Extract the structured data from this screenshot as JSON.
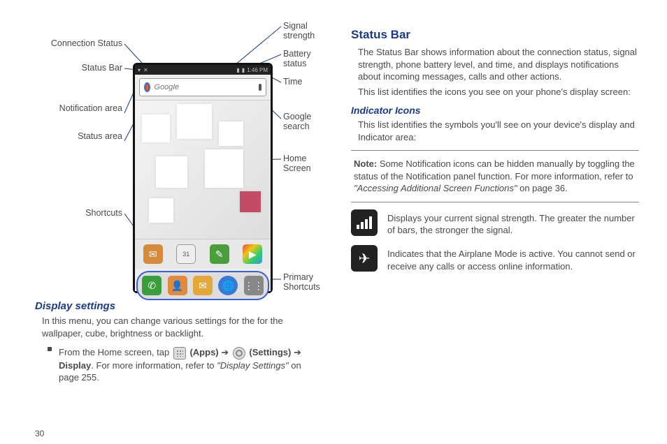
{
  "labels": {
    "connection_status": "Connection Status",
    "status_bar": "Status Bar",
    "notification_area": "Notification area",
    "status_area": "Status area",
    "shortcuts": "Shortcuts",
    "signal_strength": "Signal strength",
    "battery_status": "Battery status",
    "time": "Time",
    "google_search": "Google search",
    "home_screen": "Home Screen",
    "primary_shortcuts": "Primary Shortcuts"
  },
  "phone": {
    "time": "1:46 PM",
    "search_placeholder": "Google"
  },
  "left": {
    "heading": "Display settings",
    "para": "In this menu, you can change various settings for the for the wallpaper, cube, brightness or backlight.",
    "bullet_pre": "From the Home screen, tap ",
    "apps_label": "(Apps)",
    "arrow": " ➔ ",
    "settings_label": "(Settings)",
    "arrow2": " ➔ ",
    "display_label": "Display",
    "bullet_post": ". For more information, refer to ",
    "ref": "\"Display Settings\"",
    "ref_page": " on page 255."
  },
  "right": {
    "title": "Status Bar",
    "p1": "The Status Bar shows information about the connection status, signal strength, phone battery level, and time, and displays notifications about incoming messages, calls and other actions.",
    "p2": "This list identifies the icons you see on your phone's display screen:",
    "indicator_heading": "Indicator Icons",
    "p3": "This list identifies the symbols you'll see on your device's display and Indicator area:",
    "note_label": "Note:",
    "note_body": " Some Notification icons can be hidden manually by toggling the status of the Notification panel function. For more information, refer to ",
    "note_ref": "\"Accessing Additional Screen Functions\"",
    "note_page": " on page 36.",
    "signal_desc": "Displays your current signal strength. The greater the number of bars, the stronger the signal.",
    "airplane_desc": "Indicates that the Airplane Mode is active. You cannot send or receive any calls or access online information."
  },
  "page_number": "30"
}
